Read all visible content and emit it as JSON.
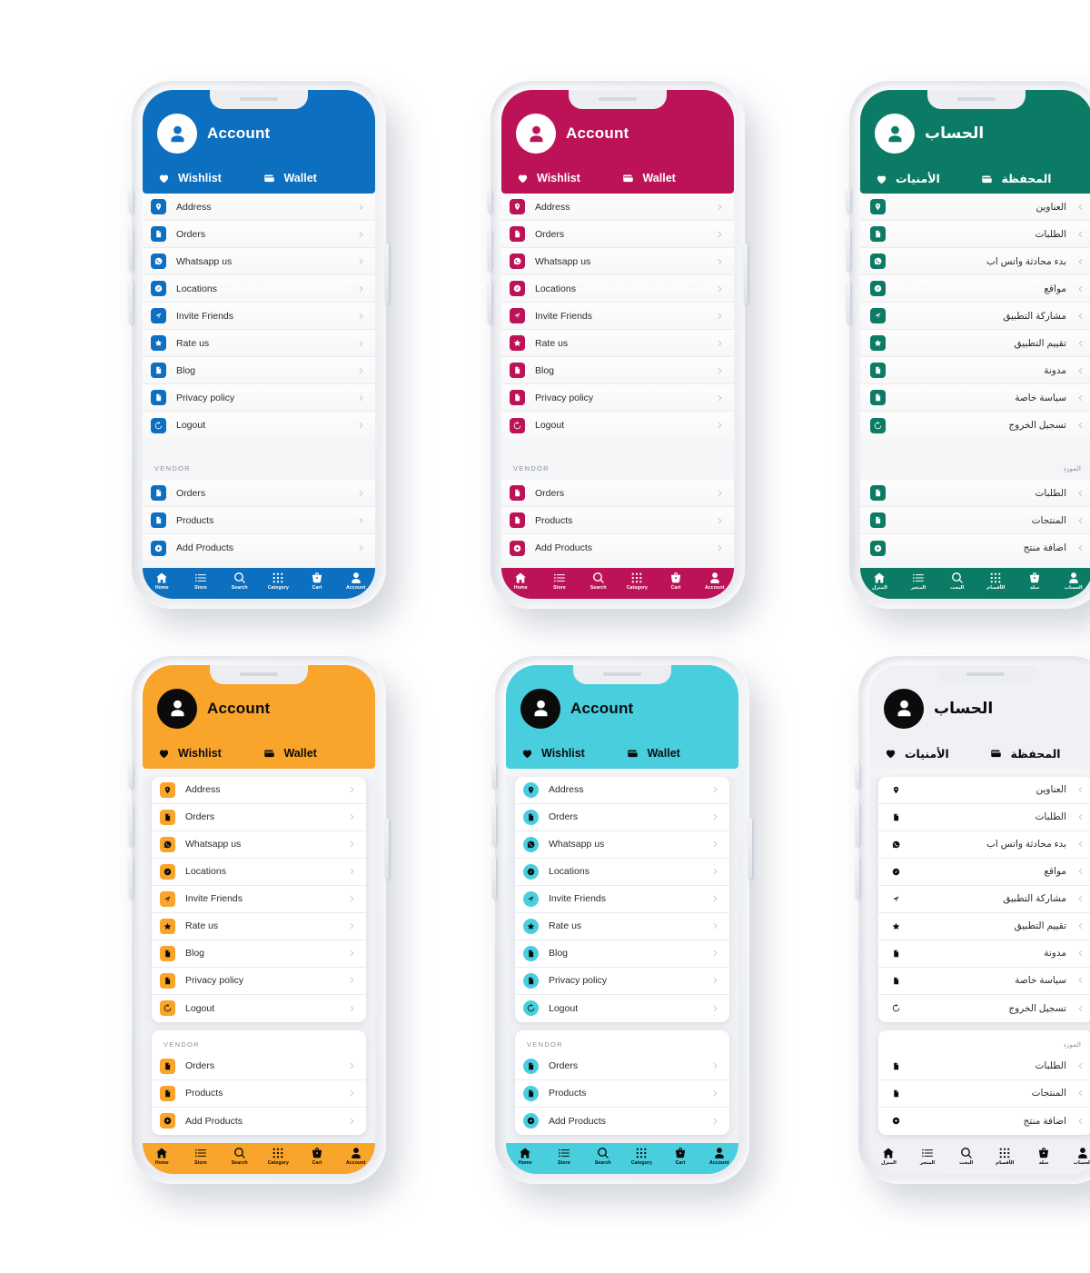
{
  "screens": [
    {
      "id": "blue",
      "lang": "en",
      "dir": "ltr",
      "badge_shape": "square",
      "card_style": "flat",
      "theme": {
        "accent": "#0D6FC0",
        "header_bg": "#0D6FC0",
        "header_fg": "#FFFFFF",
        "avatar_bg": "#FFFFFF",
        "avatar_fg": "#0D6FC0",
        "badge_bg": "#0D6FC0",
        "badge_fg": "#FFFFFF",
        "nav_bg": "#0D6FC0",
        "nav_fg": "#FFFFFF"
      },
      "header": {
        "title": "Account",
        "wishlist": "Wishlist",
        "wallet": "Wallet"
      },
      "items": [
        {
          "label": "Address",
          "icon": "location-pin-icon"
        },
        {
          "label": "Orders",
          "icon": "document-icon"
        },
        {
          "label": "Whatsapp us",
          "icon": "whatsapp-icon"
        },
        {
          "label": "Locations",
          "icon": "compass-icon"
        },
        {
          "label": "Invite Friends",
          "icon": "share-arrow-icon"
        },
        {
          "label": "Rate us",
          "icon": "star-icon"
        },
        {
          "label": "Blog",
          "icon": "document-icon"
        },
        {
          "label": "Privacy policy",
          "icon": "document-icon"
        },
        {
          "label": "Logout",
          "icon": "power-icon"
        }
      ],
      "vendor_title": "VENDOR",
      "vendor_items": [
        {
          "label": "Orders",
          "icon": "document-icon"
        },
        {
          "label": "Products",
          "icon": "document-icon"
        },
        {
          "label": "Add Products",
          "icon": "plus-circle-icon"
        }
      ],
      "nav": [
        {
          "label": "Home",
          "icon": "home-icon"
        },
        {
          "label": "Store",
          "icon": "list-icon"
        },
        {
          "label": "Search",
          "icon": "search-icon"
        },
        {
          "label": "Category",
          "icon": "grid-icon"
        },
        {
          "label": "Cart",
          "icon": "basket-icon"
        },
        {
          "label": "Account",
          "icon": "person-icon"
        }
      ]
    },
    {
      "id": "pink",
      "lang": "en",
      "dir": "ltr",
      "badge_shape": "square",
      "card_style": "flat",
      "theme": {
        "accent": "#BC1358",
        "header_bg": "#BC1358",
        "header_fg": "#FFFFFF",
        "avatar_bg": "#FFFFFF",
        "avatar_fg": "#BC1358",
        "badge_bg": "#BC1358",
        "badge_fg": "#FFFFFF",
        "nav_bg": "#BC1358",
        "nav_fg": "#FFFFFF"
      },
      "header": {
        "title": "Account",
        "wishlist": "Wishlist",
        "wallet": "Wallet"
      },
      "items": [
        {
          "label": "Address",
          "icon": "location-pin-icon"
        },
        {
          "label": "Orders",
          "icon": "document-icon"
        },
        {
          "label": "Whatsapp us",
          "icon": "whatsapp-icon"
        },
        {
          "label": "Locations",
          "icon": "compass-icon"
        },
        {
          "label": "Invite Friends",
          "icon": "share-arrow-icon"
        },
        {
          "label": "Rate us",
          "icon": "star-icon"
        },
        {
          "label": "Blog",
          "icon": "document-icon"
        },
        {
          "label": "Privacy policy",
          "icon": "document-icon"
        },
        {
          "label": "Logout",
          "icon": "power-icon"
        }
      ],
      "vendor_title": "VENDOR",
      "vendor_items": [
        {
          "label": "Orders",
          "icon": "document-icon"
        },
        {
          "label": "Products",
          "icon": "document-icon"
        },
        {
          "label": "Add Products",
          "icon": "plus-circle-icon"
        }
      ],
      "nav": [
        {
          "label": "Home",
          "icon": "home-icon"
        },
        {
          "label": "Store",
          "icon": "list-icon"
        },
        {
          "label": "Search",
          "icon": "search-icon"
        },
        {
          "label": "Category",
          "icon": "grid-icon"
        },
        {
          "label": "Cart",
          "icon": "basket-icon"
        },
        {
          "label": "Account",
          "icon": "person-icon"
        }
      ]
    },
    {
      "id": "green",
      "lang": "ar",
      "dir": "rtl",
      "badge_shape": "square",
      "card_style": "flat",
      "theme": {
        "accent": "#0B7B65",
        "header_bg": "#0B7B65",
        "header_fg": "#FFFFFF",
        "avatar_bg": "#FFFFFF",
        "avatar_fg": "#0B7B65",
        "badge_bg": "#0B7B65",
        "badge_fg": "#FFFFFF",
        "nav_bg": "#0B7B65",
        "nav_fg": "#FFFFFF"
      },
      "header": {
        "title": "الحساب",
        "wishlist": "الأمنيات",
        "wallet": "المحفظة"
      },
      "items": [
        {
          "label": "العناوين",
          "icon": "location-pin-icon"
        },
        {
          "label": "الطلبات",
          "icon": "document-icon"
        },
        {
          "label": "بدء محادثة واتس اب",
          "icon": "whatsapp-icon"
        },
        {
          "label": "مواقع",
          "icon": "compass-icon"
        },
        {
          "label": "مشاركة التطبيق",
          "icon": "share-arrow-icon"
        },
        {
          "label": "تقييم التطبيق",
          "icon": "star-icon"
        },
        {
          "label": "مدونة",
          "icon": "document-icon"
        },
        {
          "label": "سياسة خاصة",
          "icon": "document-icon"
        },
        {
          "label": "تسجيل الخروج",
          "icon": "power-icon"
        }
      ],
      "vendor_title": "المورد",
      "vendor_items": [
        {
          "label": "الطلبات",
          "icon": "document-icon"
        },
        {
          "label": "المنتجات",
          "icon": "document-icon"
        },
        {
          "label": "اضافة منتج",
          "icon": "plus-circle-icon"
        }
      ],
      "nav": [
        {
          "label": "المنزل",
          "icon": "home-icon"
        },
        {
          "label": "المتجر",
          "icon": "list-icon"
        },
        {
          "label": "البحث",
          "icon": "search-icon"
        },
        {
          "label": "الأقسام",
          "icon": "grid-icon"
        },
        {
          "label": "سلة",
          "icon": "basket-icon"
        },
        {
          "label": "الحساب",
          "icon": "person-icon"
        }
      ]
    },
    {
      "id": "orange",
      "lang": "en",
      "dir": "ltr",
      "badge_shape": "square",
      "card_style": "boxed",
      "theme": {
        "accent": "#F9A42A",
        "header_bg": "#F9A42A",
        "header_fg": "#0B0B0B",
        "avatar_bg": "#0B0B0B",
        "avatar_fg": "#FFFFFF",
        "badge_bg": "#F9A42A",
        "badge_fg": "#0B0B0B",
        "nav_bg": "#F9A42A",
        "nav_fg": "#0B0B0B"
      },
      "header": {
        "title": "Account",
        "wishlist": "Wishlist",
        "wallet": "Wallet"
      },
      "items": [
        {
          "label": "Address",
          "icon": "location-pin-icon"
        },
        {
          "label": "Orders",
          "icon": "document-icon"
        },
        {
          "label": "Whatsapp us",
          "icon": "whatsapp-icon"
        },
        {
          "label": "Locations",
          "icon": "compass-icon"
        },
        {
          "label": "Invite Friends",
          "icon": "share-arrow-icon"
        },
        {
          "label": "Rate us",
          "icon": "star-icon"
        },
        {
          "label": "Blog",
          "icon": "document-icon"
        },
        {
          "label": "Privacy policy",
          "icon": "document-icon"
        },
        {
          "label": "Logout",
          "icon": "power-icon"
        }
      ],
      "vendor_title": "VENDOR",
      "vendor_items": [
        {
          "label": "Orders",
          "icon": "document-icon"
        },
        {
          "label": "Products",
          "icon": "document-icon"
        },
        {
          "label": "Add Products",
          "icon": "plus-circle-icon"
        }
      ],
      "nav": [
        {
          "label": "Home",
          "icon": "home-icon"
        },
        {
          "label": "Store",
          "icon": "list-icon"
        },
        {
          "label": "Search",
          "icon": "search-icon"
        },
        {
          "label": "Category",
          "icon": "grid-icon"
        },
        {
          "label": "Cart",
          "icon": "basket-icon"
        },
        {
          "label": "Account",
          "icon": "person-icon"
        }
      ]
    },
    {
      "id": "cyan",
      "lang": "en",
      "dir": "ltr",
      "badge_shape": "circle",
      "card_style": "boxed",
      "theme": {
        "accent": "#49CEDE",
        "header_bg": "#49CEDE",
        "header_fg": "#0B0B0B",
        "avatar_bg": "#0B0B0B",
        "avatar_fg": "#FFFFFF",
        "badge_bg": "#49CEDE",
        "badge_fg": "#0B0B0B",
        "nav_bg": "#49CEDE",
        "nav_fg": "#0B0B0B"
      },
      "header": {
        "title": "Account",
        "wishlist": "Wishlist",
        "wallet": "Wallet"
      },
      "items": [
        {
          "label": "Address",
          "icon": "location-pin-icon"
        },
        {
          "label": "Orders",
          "icon": "document-icon"
        },
        {
          "label": "Whatsapp us",
          "icon": "whatsapp-icon"
        },
        {
          "label": "Locations",
          "icon": "compass-icon"
        },
        {
          "label": "Invite Friends",
          "icon": "share-arrow-icon"
        },
        {
          "label": "Rate us",
          "icon": "star-icon"
        },
        {
          "label": "Blog",
          "icon": "document-icon"
        },
        {
          "label": "Privacy policy",
          "icon": "document-icon"
        },
        {
          "label": "Logout",
          "icon": "power-icon"
        }
      ],
      "vendor_title": "VENDOR",
      "vendor_items": [
        {
          "label": "Orders",
          "icon": "document-icon"
        },
        {
          "label": "Products",
          "icon": "document-icon"
        },
        {
          "label": "Add Products",
          "icon": "plus-circle-icon"
        }
      ],
      "nav": [
        {
          "label": "Home",
          "icon": "home-icon"
        },
        {
          "label": "Store",
          "icon": "list-icon"
        },
        {
          "label": "Search",
          "icon": "search-icon"
        },
        {
          "label": "Category",
          "icon": "grid-icon"
        },
        {
          "label": "Cart",
          "icon": "basket-icon"
        },
        {
          "label": "Account",
          "icon": "person-icon"
        }
      ]
    },
    {
      "id": "white",
      "lang": "ar",
      "dir": "rtl",
      "badge_shape": "none",
      "card_style": "boxed",
      "theme": {
        "accent": "#0B0B0B",
        "header_bg": "#F0F1F4",
        "header_fg": "#0B0B0B",
        "avatar_bg": "#0B0B0B",
        "avatar_fg": "#FFFFFF",
        "badge_bg": "transparent",
        "badge_fg": "#0B0B0B",
        "nav_bg": "#F0F1F4",
        "nav_fg": "#0B0B0B"
      },
      "header": {
        "title": "الحساب",
        "wishlist": "الأمنيات",
        "wallet": "المحفظة"
      },
      "items": [
        {
          "label": "العناوين",
          "icon": "location-pin-icon"
        },
        {
          "label": "الطلبات",
          "icon": "document-icon"
        },
        {
          "label": "بدء محادثة واتس اب",
          "icon": "whatsapp-icon"
        },
        {
          "label": "مواقع",
          "icon": "compass-icon"
        },
        {
          "label": "مشاركة التطبيق",
          "icon": "share-arrow-icon"
        },
        {
          "label": "تقييم التطبيق",
          "icon": "star-icon"
        },
        {
          "label": "مدونة",
          "icon": "document-icon"
        },
        {
          "label": "سياسة خاصة",
          "icon": "document-icon"
        },
        {
          "label": "تسجيل الخروج",
          "icon": "power-icon"
        }
      ],
      "vendor_title": "المورد",
      "vendor_items": [
        {
          "label": "الطلبات",
          "icon": "document-icon"
        },
        {
          "label": "المنتجات",
          "icon": "document-icon"
        },
        {
          "label": "اضافة منتج",
          "icon": "plus-circle-icon"
        }
      ],
      "nav": [
        {
          "label": "المنزل",
          "icon": "home-icon"
        },
        {
          "label": "المتجر",
          "icon": "list-icon"
        },
        {
          "label": "البحث",
          "icon": "search-icon"
        },
        {
          "label": "الأقسام",
          "icon": "grid-icon"
        },
        {
          "label": "سلة",
          "icon": "basket-icon"
        },
        {
          "label": "الحساب",
          "icon": "person-icon"
        }
      ]
    }
  ]
}
